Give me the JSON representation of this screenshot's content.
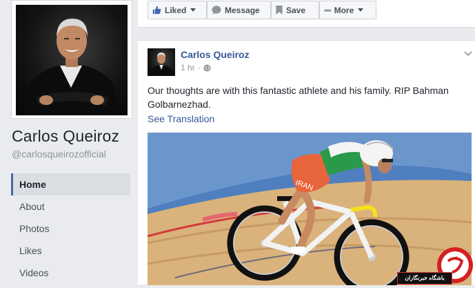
{
  "profile": {
    "name": "Carlos Queiroz",
    "handle": "@carlosqueirozofficial"
  },
  "nav": {
    "items": [
      {
        "label": "Home",
        "active": true
      },
      {
        "label": "About",
        "active": false
      },
      {
        "label": "Photos",
        "active": false
      },
      {
        "label": "Likes",
        "active": false
      },
      {
        "label": "Videos",
        "active": false
      }
    ]
  },
  "actions": {
    "liked": "Liked",
    "message": "Message",
    "save": "Save",
    "more": "More"
  },
  "post": {
    "author": "Carlos Queiroz",
    "time": "1 hr",
    "text": "Our thoughts are with this fantastic athlete and his family. RIP Bahman Golbarnezhad.",
    "see_translation": "See Translation",
    "jersey_text": "IRAN"
  },
  "watermark": {
    "text": "باشگاه خبرنگاران"
  },
  "colors": {
    "link_blue": "#365899",
    "accent": "#4267b2",
    "page_bg": "#e9ebee"
  }
}
